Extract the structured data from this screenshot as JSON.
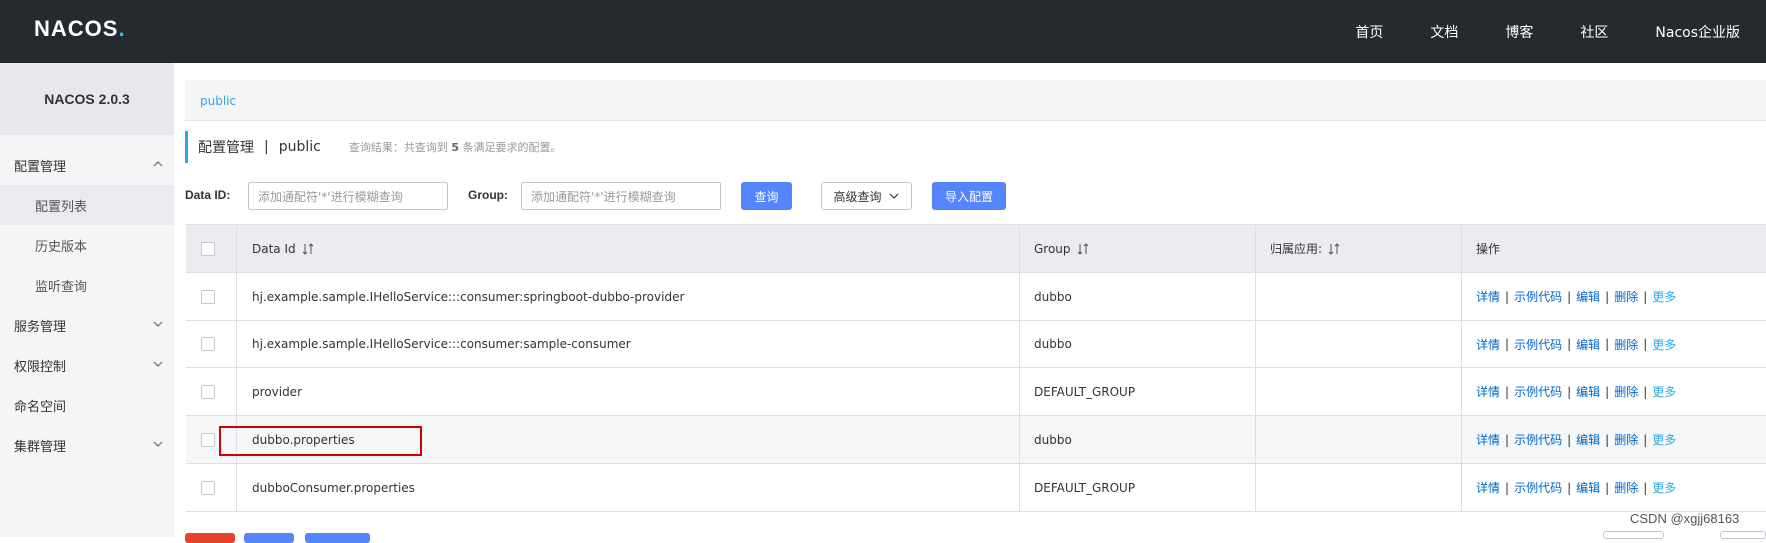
{
  "app": {
    "logo_text": "NACOS",
    "logo_dot": ".",
    "version": "NACOS 2.0.3"
  },
  "topnav": [
    "首页",
    "文档",
    "博客",
    "社区",
    "Nacos企业版"
  ],
  "sidebar": {
    "items": [
      {
        "label": "配置管理",
        "expanded": true
      },
      {
        "label": "配置列表",
        "active": true
      },
      {
        "label": "历史版本"
      },
      {
        "label": "监听查询"
      },
      {
        "label": "服务管理"
      },
      {
        "label": "权限控制"
      },
      {
        "label": "命名空间"
      },
      {
        "label": "集群管理"
      }
    ]
  },
  "breadcrumb": "public",
  "heading": {
    "title": "配置管理",
    "separator": "|",
    "namespace": "public",
    "result_prefix": "查询结果：共查询到",
    "result_count": "5",
    "result_suffix": "条满足要求的配置。"
  },
  "filters": {
    "dataid_label": "Data ID:",
    "dataid_placeholder": "添加通配符'*'进行模糊查询",
    "group_label": "Group:",
    "group_placeholder": "添加通配符'*'进行模糊查询",
    "query_button": "查询",
    "advanced_button": "高级查询",
    "import_button": "导入配置"
  },
  "table": {
    "columns": [
      "Data Id",
      "Group",
      "归属应用:",
      "操作"
    ],
    "rows": [
      {
        "data_id": "hj.example.sample.IHelloService:::consumer:springboot-dubbo-provider",
        "group": "dubbo",
        "app": ""
      },
      {
        "data_id": "hj.example.sample.IHelloService:::consumer:sample-consumer",
        "group": "dubbo",
        "app": ""
      },
      {
        "data_id": "provider",
        "group": "DEFAULT_GROUP",
        "app": ""
      },
      {
        "data_id": "dubbo.properties",
        "group": "dubbo",
        "app": ""
      },
      {
        "data_id": "dubboConsumer.properties",
        "group": "DEFAULT_GROUP",
        "app": ""
      }
    ],
    "ops": [
      "详情",
      "示例代码",
      "编辑",
      "删除",
      "更多"
    ],
    "op_separator": "|"
  },
  "watermark": "CSDN @xgjj68163",
  "colors": {
    "topbar": "#252a2f",
    "accent": "#2fa7e8",
    "primary_button": "#5584ff",
    "highlight_box": "#d40000"
  }
}
